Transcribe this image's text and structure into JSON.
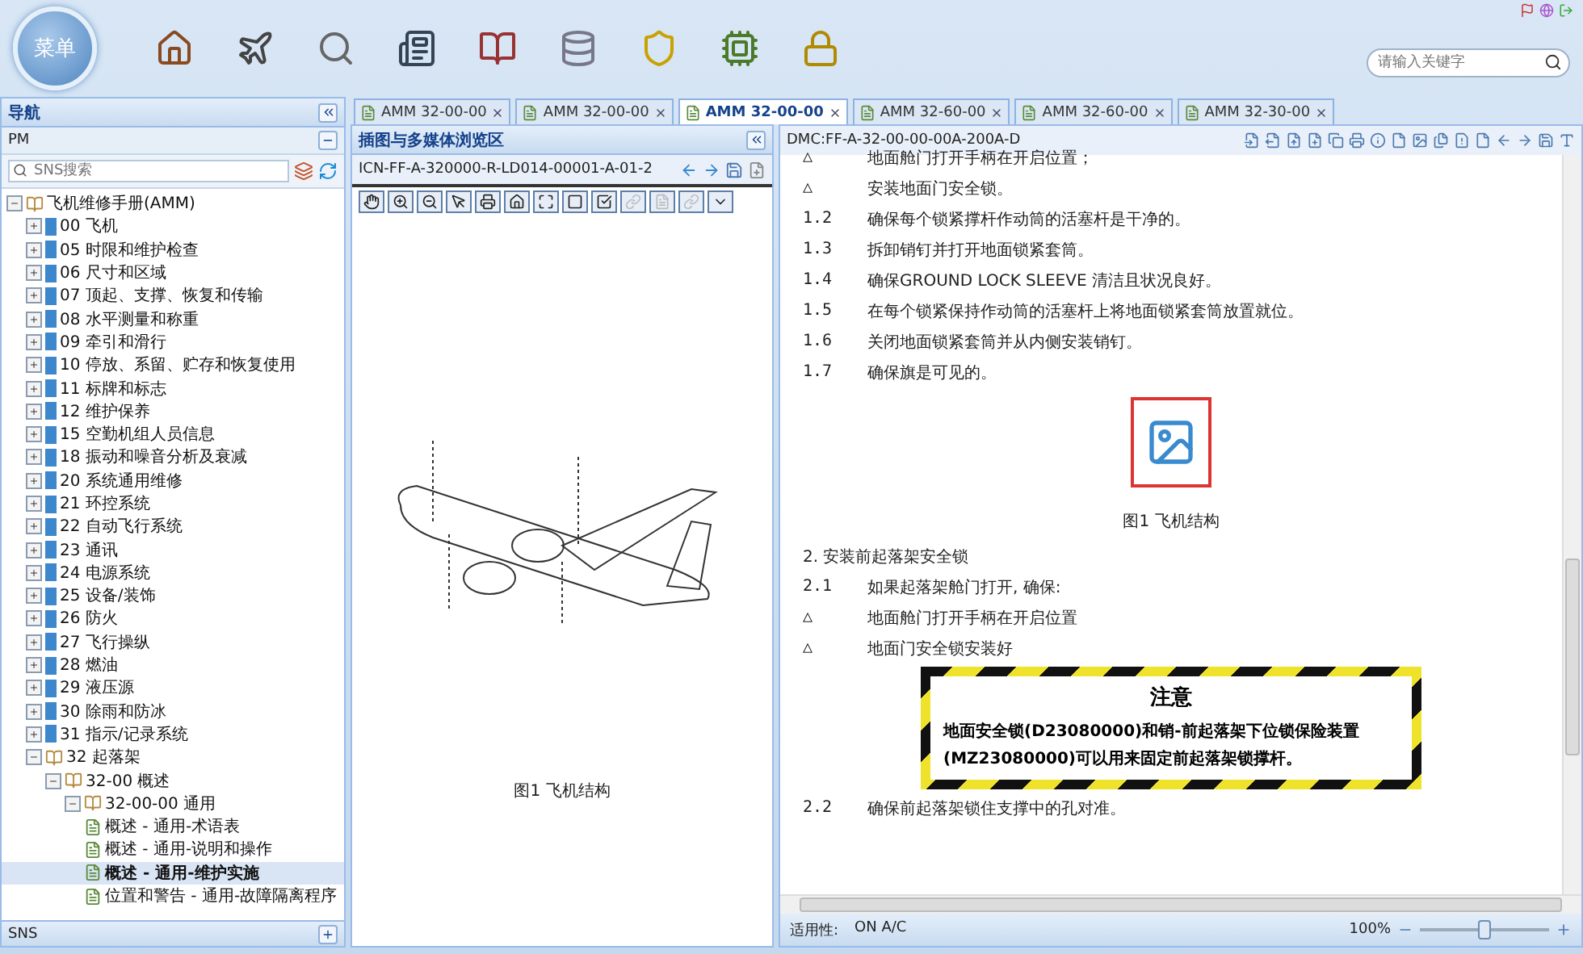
{
  "header": {
    "menu_label": "菜单",
    "search": {
      "placeholder": "请输入关键字"
    }
  },
  "nav": {
    "title": "导航",
    "section": "PM",
    "search": {
      "placeholder": "SNS搜索"
    },
    "footer": "SNS",
    "tree": [
      {
        "label": "飞机维修手册(AMM)",
        "kind": "book",
        "expanded": true,
        "selected": false,
        "children": [
          {
            "label": "00 飞机",
            "kind": "chapter",
            "expanded": false,
            "selected": false
          },
          {
            "label": "05 时限和维护检查",
            "kind": "chapter",
            "expanded": false,
            "selected": false
          },
          {
            "label": "06 尺寸和区域",
            "kind": "chapter",
            "expanded": false,
            "selected": false
          },
          {
            "label": "07 顶起、支撑、恢复和传输",
            "kind": "chapter",
            "expanded": false,
            "selected": false
          },
          {
            "label": "08 水平测量和称重",
            "kind": "chapter",
            "expanded": false,
            "selected": false
          },
          {
            "label": "09 牵引和滑行",
            "kind": "chapter",
            "expanded": false,
            "selected": false
          },
          {
            "label": "10 停放、系留、贮存和恢复使用",
            "kind": "chapter",
            "expanded": false,
            "selected": false
          },
          {
            "label": "11 标牌和标志",
            "kind": "chapter",
            "expanded": false,
            "selected": false
          },
          {
            "label": "12 维护保养",
            "kind": "chapter",
            "expanded": false,
            "selected": false
          },
          {
            "label": "15 空勤机组人员信息",
            "kind": "chapter",
            "expanded": false,
            "selected": false
          },
          {
            "label": "18 振动和噪音分析及衰减",
            "kind": "chapter",
            "expanded": false,
            "selected": false
          },
          {
            "label": "20 系统通用维修",
            "kind": "chapter",
            "expanded": false,
            "selected": false
          },
          {
            "label": "21 环控系统",
            "kind": "chapter",
            "expanded": false,
            "selected": false
          },
          {
            "label": "22 自动飞行系统",
            "kind": "chapter",
            "expanded": false,
            "selected": false
          },
          {
            "label": "23 通讯",
            "kind": "chapter",
            "expanded": false,
            "selected": false
          },
          {
            "label": "24 电源系统",
            "kind": "chapter",
            "expanded": false,
            "selected": false
          },
          {
            "label": "25 设备/装饰",
            "kind": "chapter",
            "expanded": false,
            "selected": false
          },
          {
            "label": "26 防火",
            "kind": "chapter",
            "expanded": false,
            "selected": false
          },
          {
            "label": "27 飞行操纵",
            "kind": "chapter",
            "expanded": false,
            "selected": false
          },
          {
            "label": "28 燃油",
            "kind": "chapter",
            "expanded": false,
            "selected": false
          },
          {
            "label": "29 液压源",
            "kind": "chapter",
            "expanded": false,
            "selected": false
          },
          {
            "label": "30 除雨和防冰",
            "kind": "chapter",
            "expanded": false,
            "selected": false
          },
          {
            "label": "31 指示/记录系统",
            "kind": "chapter",
            "expanded": false,
            "selected": false
          },
          {
            "label": "32 起落架",
            "kind": "book",
            "expanded": true,
            "selected": false,
            "children": [
              {
                "label": "32-00 概述",
                "kind": "book",
                "expanded": true,
                "selected": false,
                "children": [
                  {
                    "label": "32-00-00 通用",
                    "kind": "book",
                    "expanded": true,
                    "selected": false,
                    "children": [
                      {
                        "label": "概述 - 通用-术语表",
                        "kind": "doc",
                        "selected": false
                      },
                      {
                        "label": "概述 - 通用-说明和操作",
                        "kind": "doc",
                        "selected": false
                      },
                      {
                        "label": "概述 - 通用-维护实施",
                        "kind": "doc",
                        "selected": true
                      },
                      {
                        "label": "位置和警告 - 通用-故障隔离程序",
                        "kind": "doc",
                        "selected": false
                      }
                    ]
                  }
                ]
              }
            ]
          }
        ]
      }
    ]
  },
  "tabs": [
    {
      "label": "AMM  32-00-00",
      "selected": false
    },
    {
      "label": "AMM  32-00-00",
      "selected": false
    },
    {
      "label": "AMM  32-00-00",
      "selected": true
    },
    {
      "label": "AMM  32-60-00",
      "selected": false
    },
    {
      "label": "AMM  32-60-00",
      "selected": false
    },
    {
      "label": "AMM  32-30-00",
      "selected": false
    }
  ],
  "viewer": {
    "title": "插图与多媒体浏览区",
    "icn": "ICN-FF-A-320000-R-LD014-00001-A-01-2",
    "caption": "图1 飞机结构"
  },
  "document": {
    "dmc": "DMC:FF-A-32-00-00-00A-200A-D",
    "blocks": [
      {
        "kind": "step",
        "marker": "△",
        "text": "地面舱门打开手柄在开启位置；"
      },
      {
        "kind": "step",
        "marker": "△",
        "text": "安装地面门安全锁。"
      },
      {
        "kind": "step",
        "marker": "1.2",
        "text": "确保每个锁紧撑杆作动筒的活塞杆是干净的。"
      },
      {
        "kind": "step",
        "marker": "1.3",
        "text": "拆卸销钉并打开地面锁紧套筒。"
      },
      {
        "kind": "step",
        "marker": "1.4",
        "text": "确保GROUND LOCK SLEEVE 清洁且状况良好。"
      },
      {
        "kind": "step",
        "marker": "1.5",
        "text": "在每个锁紧保持作动筒的活塞杆上将地面锁紧套筒放置就位。"
      },
      {
        "kind": "step",
        "marker": "1.6",
        "text": "关闭地面锁紧套筒并从内侧安装销钉。"
      },
      {
        "kind": "step",
        "marker": "1.7",
        "text": "确保旗是可见的。"
      },
      {
        "kind": "figure",
        "caption": "图1 飞机结构"
      },
      {
        "kind": "heading",
        "text": "2. 安装前起落架安全锁"
      },
      {
        "kind": "step",
        "marker": "2.1",
        "text": "如果起落架舱门打开, 确保:"
      },
      {
        "kind": "step",
        "marker": "△",
        "text": "地面舱门打开手柄在开启位置"
      },
      {
        "kind": "step",
        "marker": "△",
        "text": "地面门安全锁安装好"
      },
      {
        "kind": "caution",
        "title": "注意",
        "text": "地面安全锁(D23080000)和销-前起落架下位锁保险装置(MZ23080000)可以用来固定前起落架锁撑杆。"
      },
      {
        "kind": "step",
        "marker": "2.2",
        "text": "确保前起落架锁住支撑中的孔对准。"
      }
    ],
    "applicability_label": "适用性:",
    "applicability": "ON A/C",
    "zoom": {
      "reading": "100%",
      "level": 0.5
    }
  }
}
